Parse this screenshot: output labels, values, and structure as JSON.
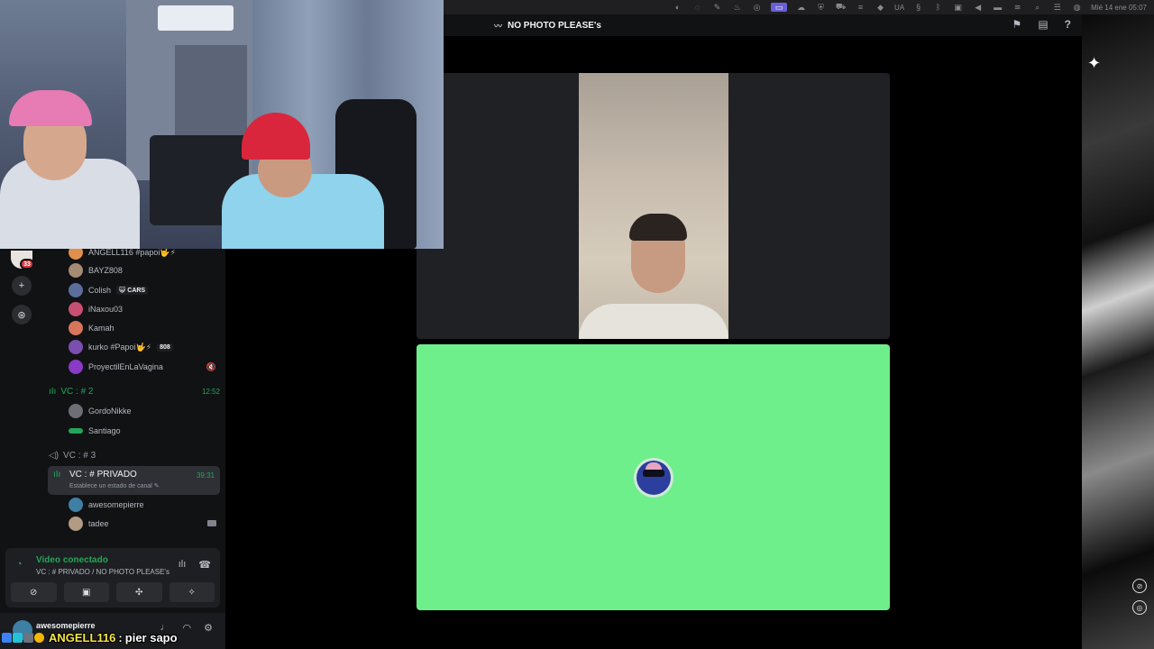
{
  "menubar": {
    "icons": [
      "app-icon",
      "circle-icon",
      "edit-icon",
      "fire-icon",
      "dashboard-icon",
      "screen-icon",
      "cloud-icon",
      "shield-icon",
      "car-icon",
      "lines-icon",
      "wave-icon"
    ],
    "input_source": "UA",
    "battery": "",
    "datetime": "Mié 14 ene  05:07"
  },
  "titlebar": {
    "title": "NO PHOTO PLEASE's"
  },
  "guilds": {
    "badge": "33"
  },
  "members_top": [
    {
      "name": "ANGELL116 #papoi🤟⚡",
      "color": "#e08f4c"
    },
    {
      "name": "BAYZ808",
      "color": "#a58a74"
    },
    {
      "name": "Colish",
      "tag": "😺 CARS",
      "color": "#5b6d9b"
    },
    {
      "name": "iNaxou03",
      "color": "#c84f74"
    },
    {
      "name": "Kamah",
      "color": "#d7765c"
    },
    {
      "name": "kurko #Papoi🤟⚡",
      "tag": "808",
      "color": "#7a4fb0"
    },
    {
      "name": "ProyectilEnLaVagina",
      "color": "#8b39c7",
      "trail": "🔇"
    }
  ],
  "vc2": {
    "name": "VC : # 2",
    "time": "12:52"
  },
  "members_vc2": [
    {
      "name": "GordoNikke",
      "color": "#6c6f76"
    },
    {
      "name": "Santiago",
      "color": "#23a55a"
    }
  ],
  "vc3": {
    "name": "VC : # 3"
  },
  "vc_private": {
    "name": "VC : # PRIVADO",
    "status": "Establece un estado de canal ✎",
    "time": "39:31"
  },
  "members_private": [
    {
      "name": "awesomepierre",
      "color": "#3f7fa4"
    },
    {
      "name": "tadee",
      "color": "#b39a82"
    }
  ],
  "voice_panel": {
    "title": "Video conectado",
    "subtitle": "VC : # PRIVADO / NO PHOTO PLEASE's",
    "buttons": [
      "camera-off-icon",
      "screen-share-icon",
      "activities-icon",
      "soundboard-icon"
    ]
  },
  "user_bar": {
    "username": "awesomepierre"
  },
  "chat_overlay": {
    "user": "ANGELL116",
    "separator": " :",
    "message": "pier sapo"
  },
  "colors": {
    "discord_green": "#23a55a",
    "tile_green": "#6fee8c",
    "bg": "#111214"
  }
}
